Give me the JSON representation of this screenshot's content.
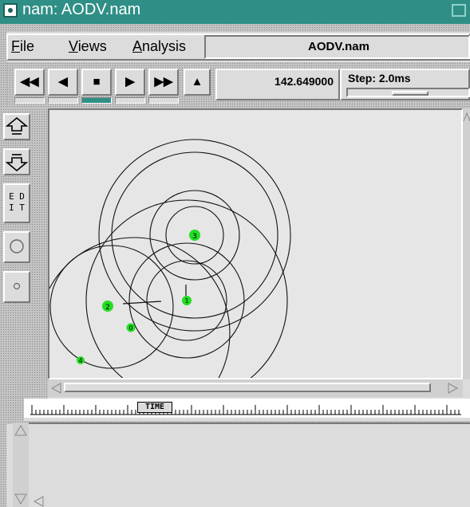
{
  "window": {
    "title": "nam: AODV.nam"
  },
  "menu": {
    "file": {
      "ul": "F",
      "rest": "ile"
    },
    "views": {
      "ul": "V",
      "rest": "iews"
    },
    "analysis": {
      "ul": "A",
      "rest": "nalysis"
    },
    "filename": "AODV.nam"
  },
  "toolbar": {
    "rewind": "◀◀",
    "back": "◀",
    "stop": "■",
    "play": "▶",
    "fast_forward": "▶▶",
    "eject": "▲",
    "active_lamp": "stop",
    "time": "142.649000",
    "step_label": "Step: 2.0ms",
    "step_slider_fraction": 0.52
  },
  "side_tools": {
    "edit_label_1": "E D",
    "edit_label_2": "I T"
  },
  "canvas": {
    "nodes": [
      {
        "id": "0",
        "x": 0.0,
        "y": 0.0
      },
      {
        "id": "1",
        "x": 0.0,
        "y": 0.0
      },
      {
        "id": "2",
        "x": 0.0,
        "y": 0.0
      },
      {
        "id": "3",
        "x": 0.0,
        "y": 0.0
      },
      {
        "id": "4",
        "x": 0.0,
        "y": 0.0
      }
    ],
    "node_color": "#22dd22"
  },
  "timeline": {
    "label": "TIME"
  }
}
